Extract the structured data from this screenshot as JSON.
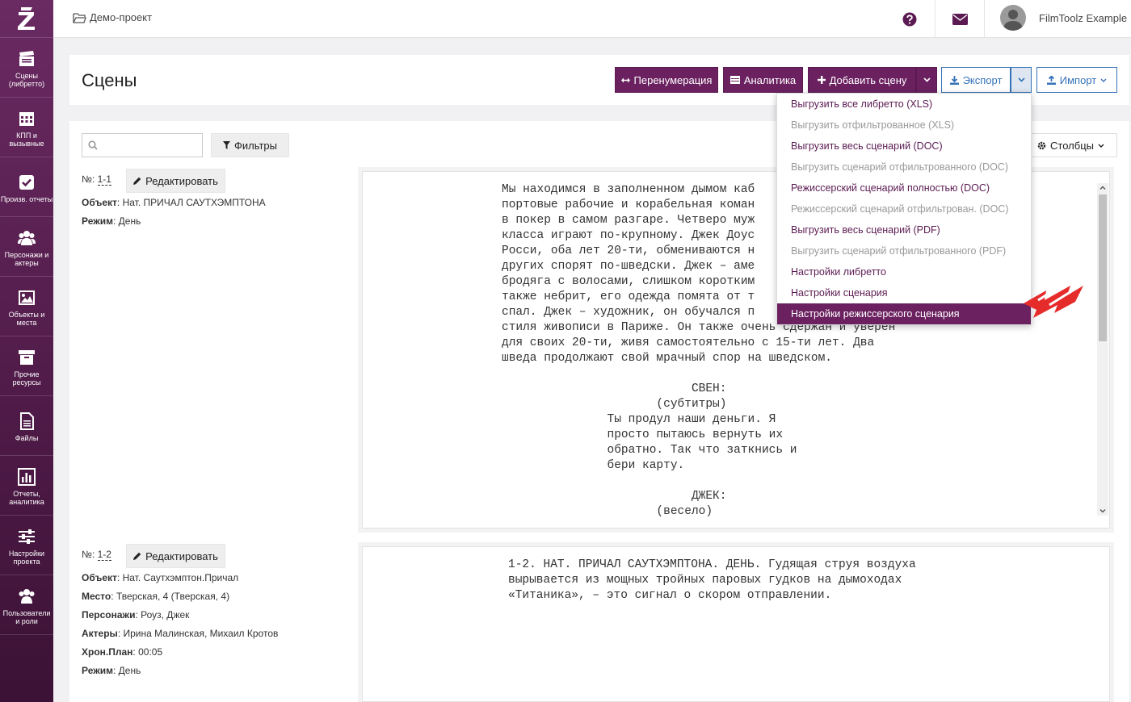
{
  "app": {
    "logo": "Z"
  },
  "sidebar": {
    "items": [
      {
        "label": "Сцены (либретто)",
        "icon": "clapperboard-icon"
      },
      {
        "label": "КПП и вызывные",
        "icon": "calendar-icon"
      },
      {
        "label": "Произв. отчеты",
        "icon": "checkbox-icon"
      },
      {
        "label": "Персонажи и актеры",
        "icon": "people-icon"
      },
      {
        "label": "Объекты и места",
        "icon": "image-icon"
      },
      {
        "label": "Прочие ресурсы",
        "icon": "archive-icon"
      },
      {
        "label": "Файлы",
        "icon": "file-icon"
      },
      {
        "label": "Отчеты, аналитика",
        "icon": "bar-chart-icon"
      },
      {
        "label": "Настройки проекта",
        "icon": "sliders-icon"
      },
      {
        "label": "Пользователи и роли",
        "icon": "users-icon"
      }
    ]
  },
  "topbar": {
    "breadcrumb": "Демо-проект",
    "user_name": "FilmToolz Example"
  },
  "header": {
    "title": "Сцены",
    "buttons": {
      "renumber": "Перенумерация",
      "analytics": "Аналитика",
      "add_scene": "Добавить сцену",
      "export": "Экспорт",
      "import": "Импорт"
    }
  },
  "toolbar": {
    "filters": "Фильтры",
    "columns": "Столбцы",
    "search_placeholder": ""
  },
  "export_menu": {
    "items": [
      {
        "label": "Выгрузить все либретто (XLS)",
        "state": "enabled"
      },
      {
        "label": "Выгрузить отфильтрованное (XLS)",
        "state": "disabled"
      },
      {
        "label": "Выгрузить весь сценарий (DOC)",
        "state": "enabled"
      },
      {
        "label": "Выгрузить сценарий отфильтрованного (DOC)",
        "state": "disabled"
      },
      {
        "label": "Режиссерский сценарий полностью (DOC)",
        "state": "enabled"
      },
      {
        "label": "Режиссерский сценарий отфильтрован. (DOC)",
        "state": "disabled"
      },
      {
        "label": "Выгрузить весь сценарий (PDF)",
        "state": "enabled"
      },
      {
        "label": "Выгрузить сценарий отфильтрованного (PDF)",
        "state": "disabled"
      },
      {
        "label": "Настройки либретто",
        "state": "enabled"
      },
      {
        "label": "Настройки сценария",
        "state": "enabled"
      },
      {
        "label": "Настройки режиссерского сценария",
        "state": "active"
      }
    ]
  },
  "scenes": [
    {
      "num_label": "№:",
      "num": "1-1",
      "edit": "Редактировать",
      "fields": [
        {
          "k": "Объект",
          "v": "Нат. ПРИЧАЛ САУТХЭМПТОНА"
        },
        {
          "k": "Режим",
          "v": "День"
        }
      ],
      "text": "Мы находимся в заполненном дымом каб\nпортовые рабочие и корабельная коман\nв покер в самом разгаре. Четверо муж\nкласса играют по-крупному. Джек Доус\nРосси, оба лет 20-ти, обмениваются н\nдругих спорят по-шведски. Джек – аме\nбродяга с волосами, слишком коротким\nтакже небрит, его одежда помята от т\nспал. Джек – художник, он обучался п\nстиля живописи в Париже. Он также очень сдержан и уверен\nдля своих 20-ти, живя самостоятельно с 15-ти лет. Два\nшведа продолжают свой мрачный спор на шведском.\n\n                           СВЕН:\n                      (субтитры)\n               Ты продул наши деньги. Я\n               просто пытаюсь вернуть их\n               обратно. Так что заткнись и\n               бери карту.\n\n                           ДЖЕК:\n                      (весело)"
    },
    {
      "num_label": "№:",
      "num": "1-2",
      "edit": "Редактировать",
      "fields": [
        {
          "k": "Объект",
          "v": "Нат. Саутхэмптон.Причал"
        },
        {
          "k": "Место",
          "v": "Тверская, 4 (Тверская, 4)"
        },
        {
          "k": "Персонажи",
          "v": "Роуз, Джек"
        },
        {
          "k": "Актеры",
          "v": "Ирина Малинская, Михаил Кротов"
        },
        {
          "k": "Хрон.План",
          "v": "00:05"
        },
        {
          "k": "Режим",
          "v": "День"
        }
      ],
      "text": "1-2. НАТ. ПРИЧАЛ САУТХЭМПТОНА. ДЕНЬ. Гудящая струя воздуха\nвырывается из мощных тройных паровых гудков на дымоходах\n«Титаника», – это сигнал о скором отправлении."
    }
  ],
  "colors": {
    "accent": "#6b2160",
    "link": "#3572b8",
    "highlight_arrow": "#e62b2b"
  }
}
